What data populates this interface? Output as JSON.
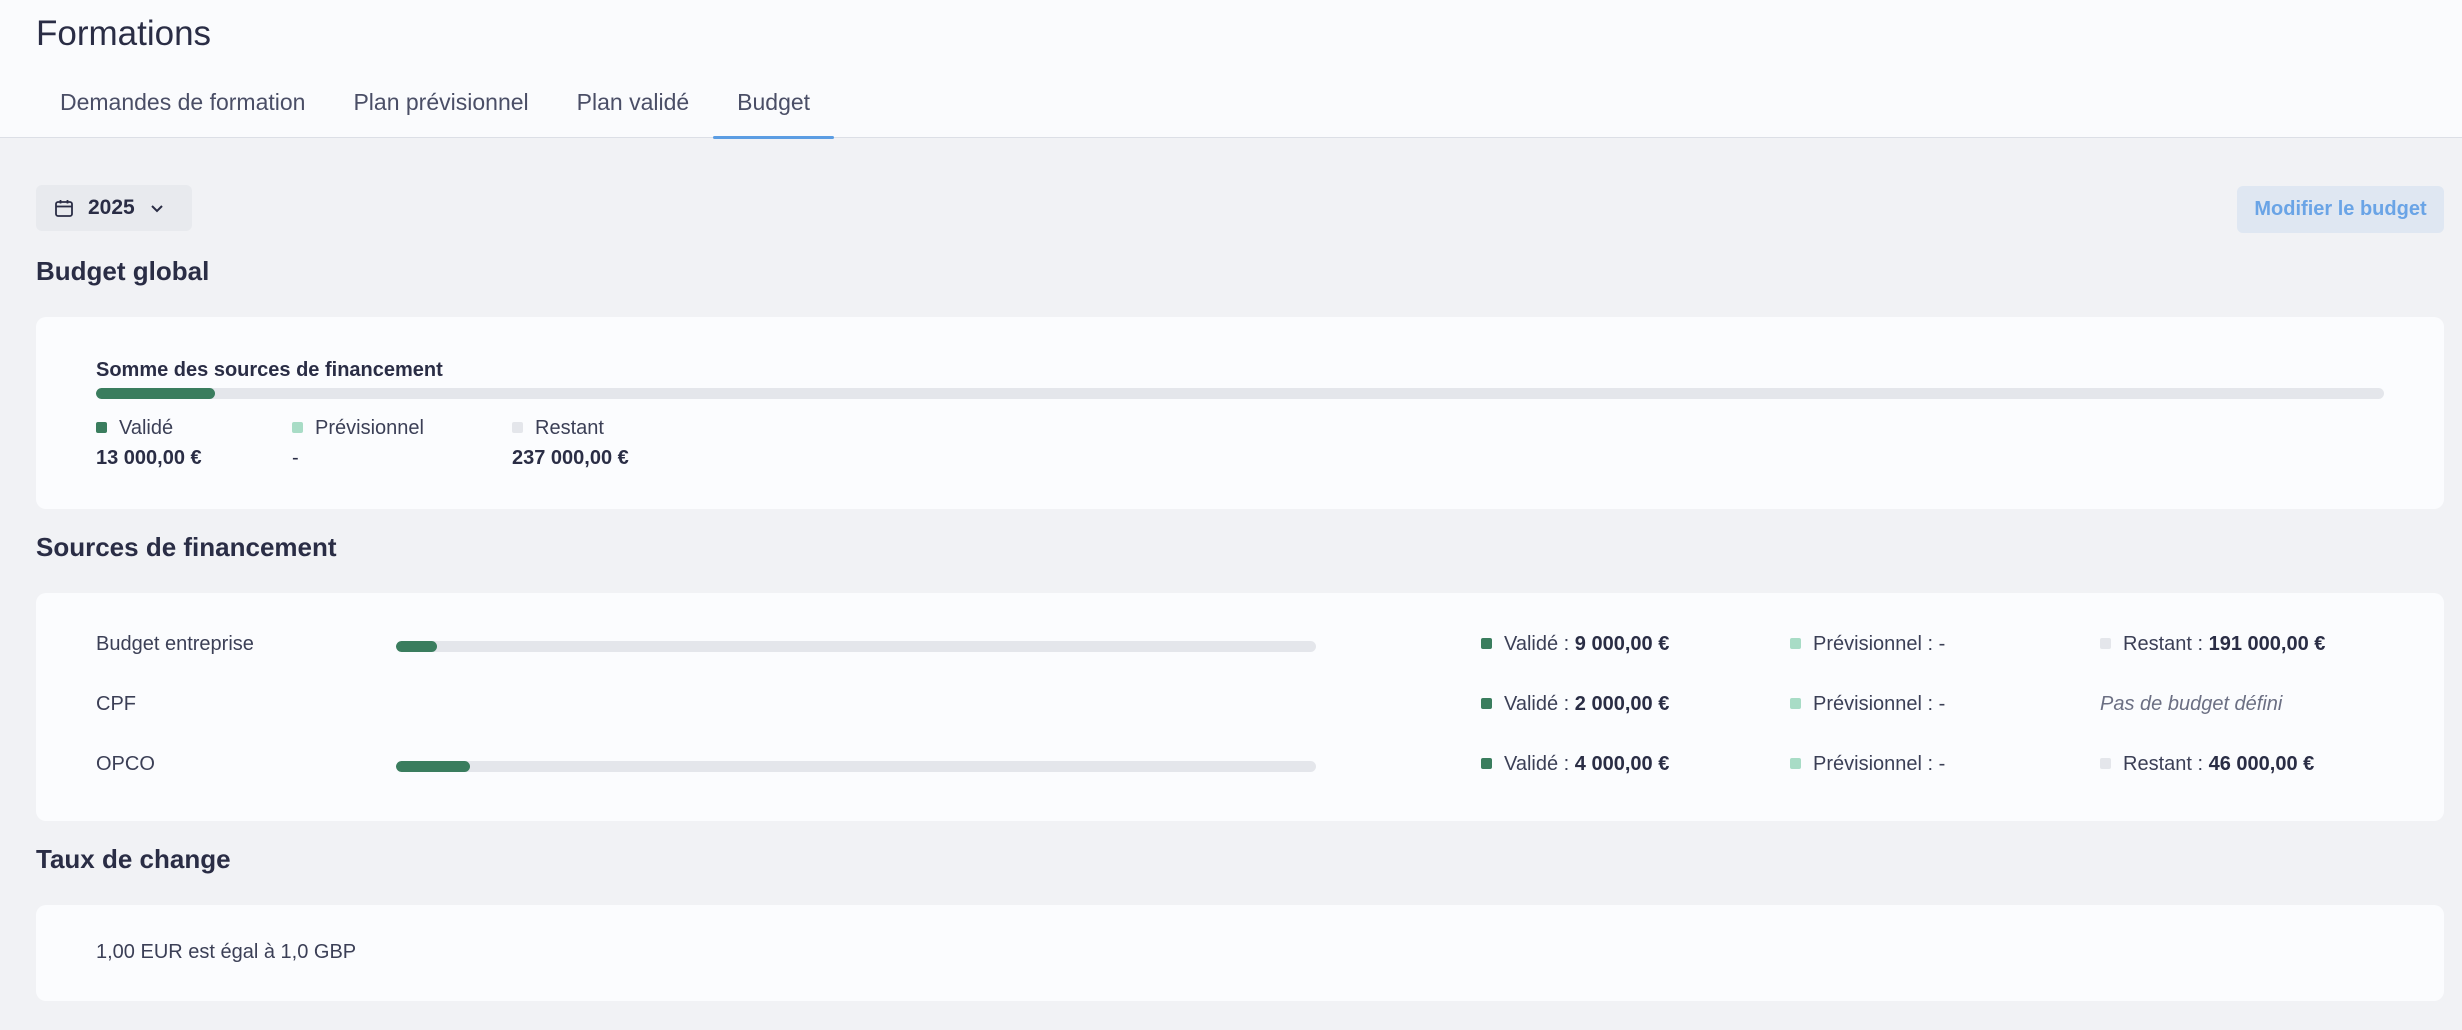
{
  "header": {
    "title": "Formations",
    "tabs": [
      {
        "label": "Demandes de formation"
      },
      {
        "label": "Plan prévisionnel"
      },
      {
        "label": "Plan validé"
      },
      {
        "label": "Budget",
        "active": true
      }
    ]
  },
  "toolbar": {
    "year": "2025",
    "modify_label": "Modifier le budget"
  },
  "global": {
    "section_title": "Budget global",
    "label": "Somme des sources de financement",
    "progress_fraction": 0.052,
    "legend": {
      "valid_label": "Validé",
      "valid_value": "13 000,00 €",
      "prev_label": "Prévisionnel",
      "prev_value": "-",
      "rest_label": "Restant",
      "rest_value": "237 000,00 €"
    }
  },
  "sources": {
    "section_title": "Sources de financement",
    "rows": [
      {
        "name": "Budget entreprise",
        "progress_fraction": 0.045,
        "valid_label": "Validé : ",
        "valid_value": "9 000,00 €",
        "prev_label": "Prévisionnel : -",
        "rest_label": "Restant : ",
        "rest_value": "191 000,00 €"
      },
      {
        "name": "CPF",
        "valid_label": "Validé : ",
        "valid_value": "2 000,00 €",
        "prev_label": "Prévisionnel : -",
        "no_budget": "Pas de budget défini"
      },
      {
        "name": "OPCO",
        "progress_fraction": 0.08,
        "valid_label": "Validé : ",
        "valid_value": "4 000,00 €",
        "prev_label": "Prévisionnel : -",
        "rest_label": "Restant : ",
        "rest_value": "46 000,00 €"
      }
    ]
  },
  "exchange": {
    "section_title": "Taux de change",
    "text": "1,00 EUR est égal à 1,0 GBP"
  },
  "colors": {
    "valid": "#3a7d5e",
    "previsionnel": "#a8dcc6",
    "restant": "#e4e6eb",
    "accent": "#5b9de3"
  }
}
